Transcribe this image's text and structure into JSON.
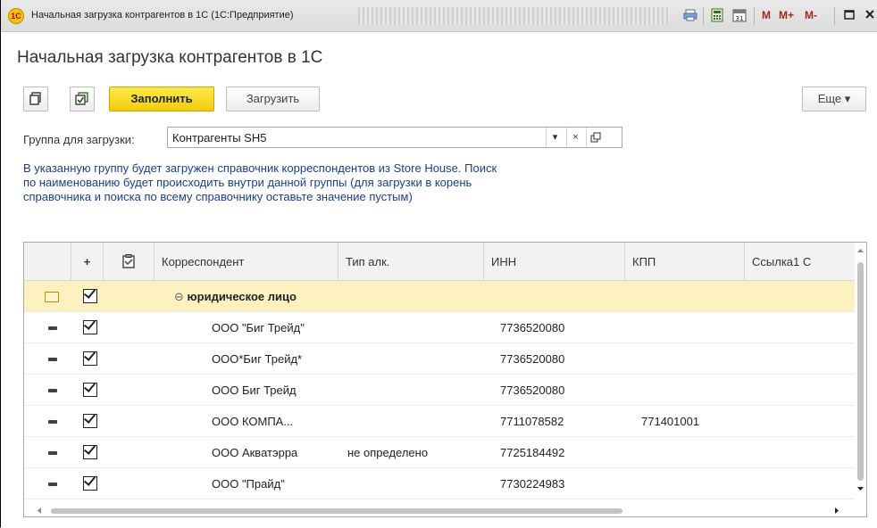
{
  "window": {
    "title": "Начальная загрузка контрагентов в 1С  (1С:Предприятие)",
    "logo_text": "1С",
    "title_buttons": [
      "M",
      "M+",
      "M-"
    ]
  },
  "form": {
    "title": "Начальная загрузка контрагентов в 1С"
  },
  "toolbar": {
    "fill_label": "Заполнить",
    "load_label": "Загрузить",
    "more_label": "Еще ▾"
  },
  "group_field": {
    "label": "Группа для загрузки:",
    "value": "Контрагенты SH5"
  },
  "hint": "В указанную группу будет загружен справочник корреспондентов из Store House. Поиск по наименованию будет происходить внутри данной группы (для загрузки в корень справочника и поиска по всему справочнику оставьте значение пустым)",
  "table": {
    "columns": {
      "plus": "+",
      "correspondent": "Корреспондент",
      "alc_type": "Тип алк.",
      "inn": "ИНН",
      "kpp": "КПП",
      "link": "Ссылка1 С"
    },
    "group_row": {
      "name": "юридическое лицо"
    },
    "rows": [
      {
        "name": "ООО \"Биг Трейд\"",
        "alc_type": "",
        "inn": "7736520080",
        "kpp": ""
      },
      {
        "name": "ООО*Биг Трейд*",
        "alc_type": "",
        "inn": "7736520080",
        "kpp": ""
      },
      {
        "name": "ООО Биг Трейд",
        "alc_type": "",
        "inn": "7736520080",
        "kpp": ""
      },
      {
        "name": "ООО КОМПА...",
        "alc_type": "",
        "inn": "7711078582",
        "kpp": "771401001"
      },
      {
        "name": "ООО Акватэрра",
        "alc_type": "не определено",
        "inn": "7725184492",
        "kpp": ""
      },
      {
        "name": "ООО \"Прайд\"",
        "alc_type": "",
        "inn": "7730224983",
        "kpp": ""
      }
    ]
  }
}
